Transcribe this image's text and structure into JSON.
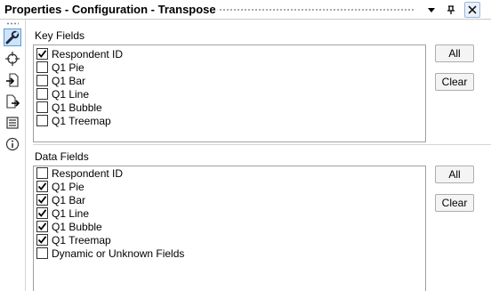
{
  "window": {
    "title": "Properties - Configuration - Transpose",
    "menu_icon": "chevron-down-icon",
    "pin_icon": "pin-icon",
    "close_icon": "close-icon",
    "menu_glyph": "▾",
    "pin_glyph": "⊣",
    "close_glyph": "✕"
  },
  "sidebar": {
    "items": [
      {
        "icon": "wrench-icon",
        "active": true
      },
      {
        "icon": "crosshair-icon",
        "active": false
      },
      {
        "icon": "input-file-icon",
        "active": false
      },
      {
        "icon": "output-file-icon",
        "active": false
      },
      {
        "icon": "annotation-icon",
        "active": false
      },
      {
        "icon": "info-icon",
        "active": false
      }
    ]
  },
  "key_fields": {
    "label": "Key Fields",
    "all_label": "All",
    "clear_label": "Clear",
    "items": [
      {
        "label": "Respondent ID",
        "checked": true
      },
      {
        "label": "Q1 Pie",
        "checked": false
      },
      {
        "label": "Q1 Bar",
        "checked": false
      },
      {
        "label": "Q1 Line",
        "checked": false
      },
      {
        "label": "Q1 Bubble",
        "checked": false
      },
      {
        "label": "Q1 Treemap",
        "checked": false
      }
    ]
  },
  "data_fields": {
    "label": "Data Fields",
    "all_label": "All",
    "clear_label": "Clear",
    "items": [
      {
        "label": "Respondent ID",
        "checked": false
      },
      {
        "label": "Q1 Pie",
        "checked": true
      },
      {
        "label": "Q1 Bar",
        "checked": true
      },
      {
        "label": "Q1 Line",
        "checked": true
      },
      {
        "label": "Q1 Bubble",
        "checked": true
      },
      {
        "label": "Q1 Treemap",
        "checked": true
      },
      {
        "label": "Dynamic or Unknown Fields",
        "checked": false
      }
    ]
  }
}
